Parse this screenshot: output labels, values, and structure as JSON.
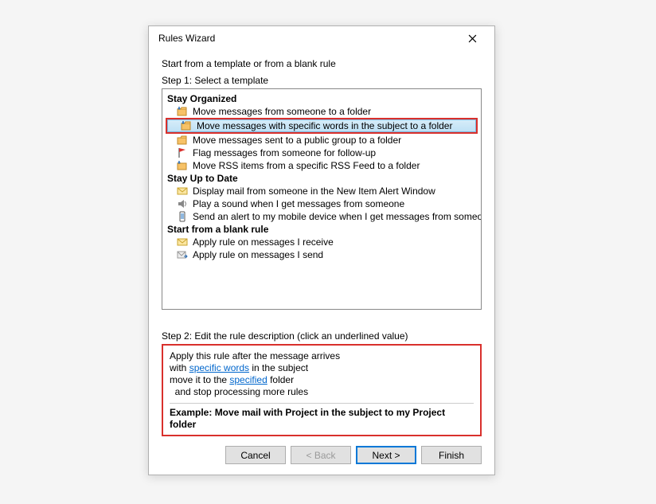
{
  "dialog": {
    "title": "Rules Wizard",
    "intro": "Start from a template or from a blank rule",
    "step1_label": "Step 1: Select a template",
    "step2_label": "Step 2: Edit the rule description (click an underlined value)"
  },
  "groups": {
    "organized": {
      "header": "Stay Organized",
      "t0": "Move messages from someone to a folder",
      "t1": "Move messages with specific words in the subject to a folder",
      "t2": "Move messages sent to a public group to a folder",
      "t3": "Flag messages from someone for follow-up",
      "t4": "Move RSS items from a specific RSS Feed to a folder"
    },
    "uptodate": {
      "header": "Stay Up to Date",
      "t0": "Display mail from someone in the New Item Alert Window",
      "t1": "Play a sound when I get messages from someone",
      "t2": "Send an alert to my mobile device when I get messages from someone"
    },
    "blank": {
      "header": "Start from a blank rule",
      "t0": "Apply rule on messages I receive",
      "t1": "Apply rule on messages I send"
    }
  },
  "description": {
    "line1": "Apply this rule after the message arrives",
    "line2_pre": "with ",
    "line2_link": "specific words",
    "line2_post": " in the subject",
    "line3_pre": "move it to the ",
    "line3_link": "specified",
    "line3_post": " folder",
    "line4": "  and stop processing more rules",
    "example": "Example: Move mail with Project in the subject to my Project folder"
  },
  "buttons": {
    "cancel": "Cancel",
    "back": "< Back",
    "next": "Next >",
    "finish": "Finish"
  }
}
